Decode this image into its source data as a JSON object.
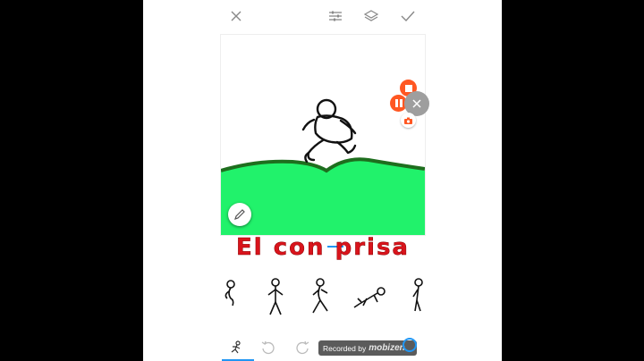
{
  "toolbar": {
    "close_icon": "close-icon",
    "adjust_icon": "sliders-icon",
    "layers_icon": "layers-icon",
    "confirm_icon": "check-icon"
  },
  "caption": {
    "text": "El con prisa"
  },
  "recorder": {
    "label": "Recorded by",
    "brand": "mobizen"
  },
  "colors": {
    "grass": "#21f26b",
    "grass_edge": "#1e6e1e",
    "record_orange": "#ff5722",
    "caption_red": "#d9141c",
    "selected_tool": "#2196f3"
  }
}
